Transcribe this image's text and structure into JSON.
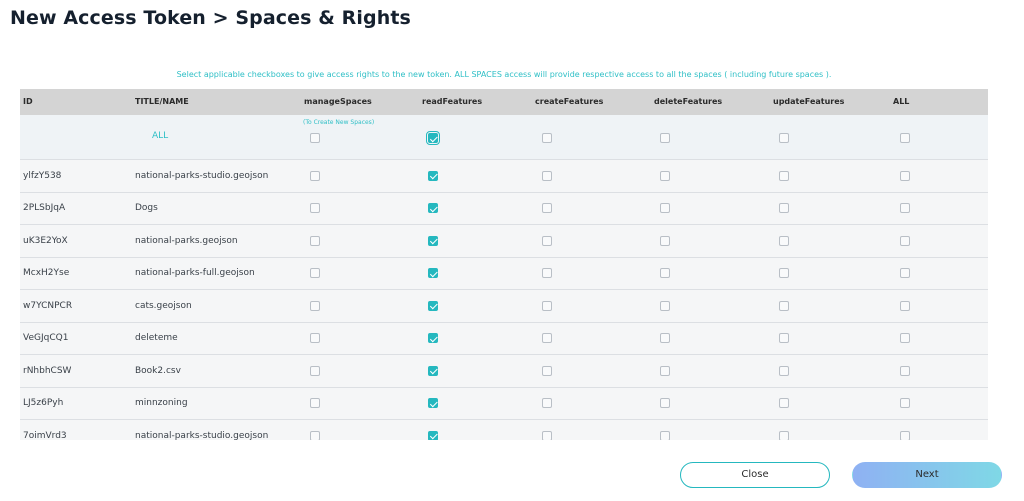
{
  "page": {
    "title": "New Access Token > Spaces & Rights",
    "hint": "Select applicable checkboxes to give access rights to the new token. ALL SPACES access will provide respective access to all the spaces ( including future spaces )."
  },
  "table": {
    "headers": [
      "ID",
      "TITLE/NAME",
      "manageSpaces",
      "readFeatures",
      "createFeatures",
      "deleteFeatures",
      "updateFeatures",
      "ALL"
    ],
    "all_row": {
      "label": "ALL",
      "manage_note": "(To Create New Spaces)",
      "checks": [
        false,
        true,
        false,
        false,
        false,
        false
      ]
    },
    "rows": [
      {
        "id": "ylfzY538",
        "name": "national-parks-studio.geojson",
        "checks": [
          false,
          true,
          false,
          false,
          false,
          false
        ]
      },
      {
        "id": "2PLSbJqA",
        "name": "Dogs",
        "checks": [
          false,
          true,
          false,
          false,
          false,
          false
        ]
      },
      {
        "id": "uK3E2YoX",
        "name": "national-parks.geojson",
        "checks": [
          false,
          true,
          false,
          false,
          false,
          false
        ]
      },
      {
        "id": "McxH2Yse",
        "name": "national-parks-full.geojson",
        "checks": [
          false,
          true,
          false,
          false,
          false,
          false
        ]
      },
      {
        "id": "w7YCNPCR",
        "name": "cats.geojson",
        "checks": [
          false,
          true,
          false,
          false,
          false,
          false
        ]
      },
      {
        "id": "VeGJqCQ1",
        "name": "deleteme",
        "checks": [
          false,
          true,
          false,
          false,
          false,
          false
        ]
      },
      {
        "id": "rNhbhCSW",
        "name": "Book2.csv",
        "checks": [
          false,
          true,
          false,
          false,
          false,
          false
        ]
      },
      {
        "id": "LJ5z6Pyh",
        "name": "minnzoning",
        "checks": [
          false,
          true,
          false,
          false,
          false,
          false
        ]
      },
      {
        "id": "7oimVrd3",
        "name": "national-parks-studio.geojson",
        "checks": [
          false,
          true,
          false,
          false,
          false,
          false
        ]
      }
    ]
  },
  "buttons": {
    "close": "Close",
    "next": "Next"
  },
  "colors": {
    "accent": "#25b8bf",
    "header_bg": "#d4d4d4",
    "next_gradient_start": "#8fb1f3",
    "next_gradient_end": "#7fd8e6"
  }
}
